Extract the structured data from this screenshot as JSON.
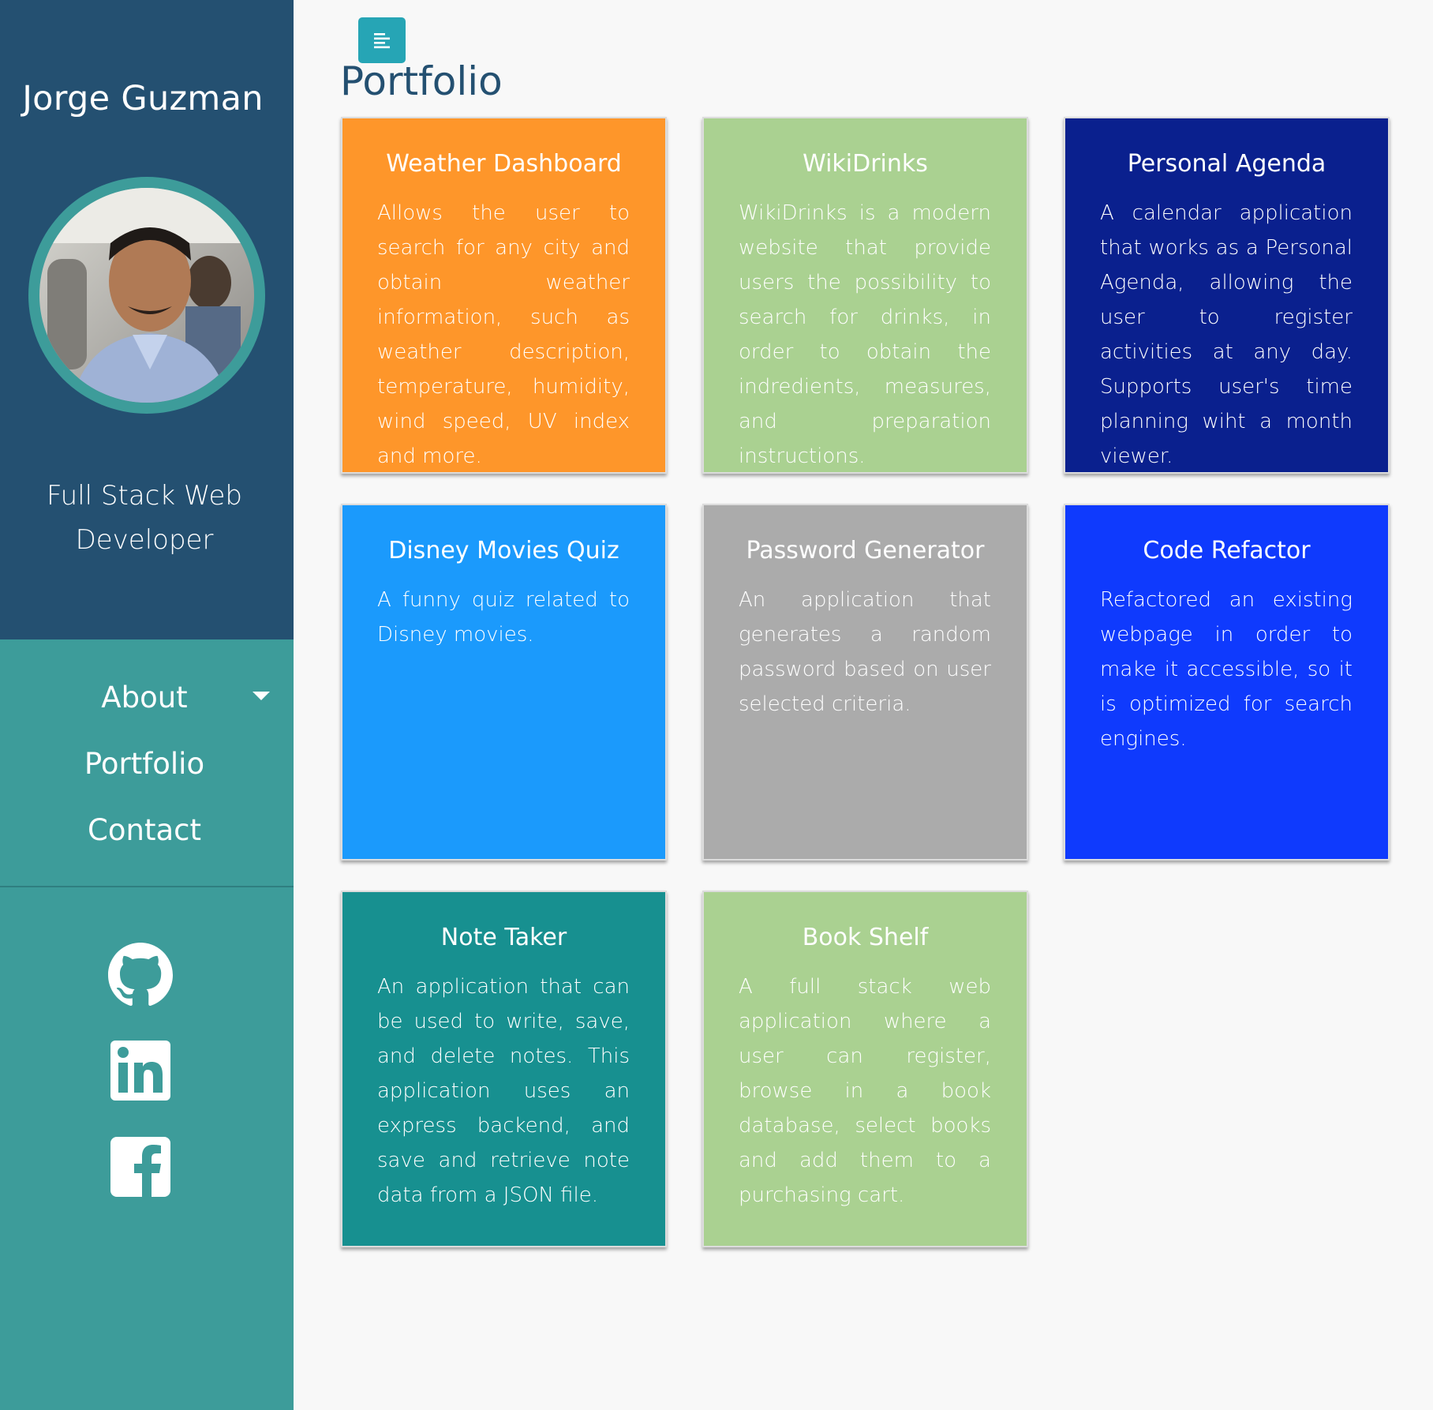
{
  "sidebar": {
    "owner_name": "Jorge Guzman",
    "role": "Full Stack Web Developer",
    "nav": [
      {
        "label": "About",
        "has_dropdown": true
      },
      {
        "label": "Portfolio"
      },
      {
        "label": "Contact"
      }
    ],
    "social": [
      "github-icon",
      "linkedin-icon",
      "facebook-icon"
    ]
  },
  "main": {
    "title": "Portfolio",
    "menu_icon": "align-left-icon",
    "projects": [
      {
        "title": "Weather Dashboard",
        "description": "Allows the user to search for any city and obtain weather information, such as weather description, temperature, humidity, wind speed, UV index and more.",
        "color": "#fe962a"
      },
      {
        "title": "WikiDrinks",
        "description": "WikiDrinks is a modern website that provide users the possibility to search for drinks, in order to obtain the indredients, measures, and preparation instructions.",
        "color": "#aad191"
      },
      {
        "title": "Personal Agenda",
        "description": "A calendar application that works as a Personal Agenda, allowing the user to register activities at any day. Supports user's time planning wiht a month viewer.",
        "color": "#0a208e"
      },
      {
        "title": "Disney Movies Quiz",
        "description": "A funny quiz related to Disney movies.",
        "color": "#1b9afc"
      },
      {
        "title": "Password Generator",
        "description": "An application that generates a random password based on user selected criteria.",
        "color": "#ababab"
      },
      {
        "title": "Code Refactor",
        "description": "Refactored an existing webpage in order to make it accessible, so it is optimized for search engines.",
        "color": "#0f3afd"
      },
      {
        "title": "Note Taker",
        "description": "An application that can be used to write, save, and delete notes. This application uses an express backend, and save and retrieve note data from a JSON file.",
        "color": "#179090"
      },
      {
        "title": "Book Shelf",
        "description": "A full stack web application where a user can register, browse in a book database, select books and add them to a purchasing cart.",
        "color": "#aad191"
      }
    ]
  },
  "colors": {
    "sidebar_top": "#245071",
    "sidebar_bottom": "#3d9c9a",
    "accent": "#26a5b5",
    "title": "#245071",
    "background": "#f8f8f8"
  }
}
